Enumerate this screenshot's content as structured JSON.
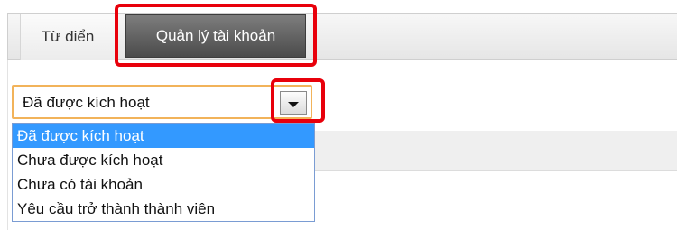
{
  "tabs": {
    "items": [
      {
        "label": "Từ điển",
        "active": false
      },
      {
        "label": "Quản lý tài khoản",
        "active": true
      }
    ]
  },
  "status_select": {
    "selected_value": "Đã được kích hoạt",
    "expanded": true,
    "options": [
      {
        "label": "Đã được kích hoạt",
        "highlighted": true
      },
      {
        "label": "Chưa được kích hoạt",
        "highlighted": false
      },
      {
        "label": "Chưa có tài khoản",
        "highlighted": false
      },
      {
        "label": "Yêu cầu trở thành thành viên",
        "highlighted": false
      }
    ]
  },
  "colors": {
    "annotation_red": "#e8000b",
    "active_tab": "#5a5a5a",
    "option_highlight": "#3399ff",
    "select_border": "#f2b35a"
  },
  "icons": {
    "dropdown_arrow": "chevron-down-icon"
  }
}
